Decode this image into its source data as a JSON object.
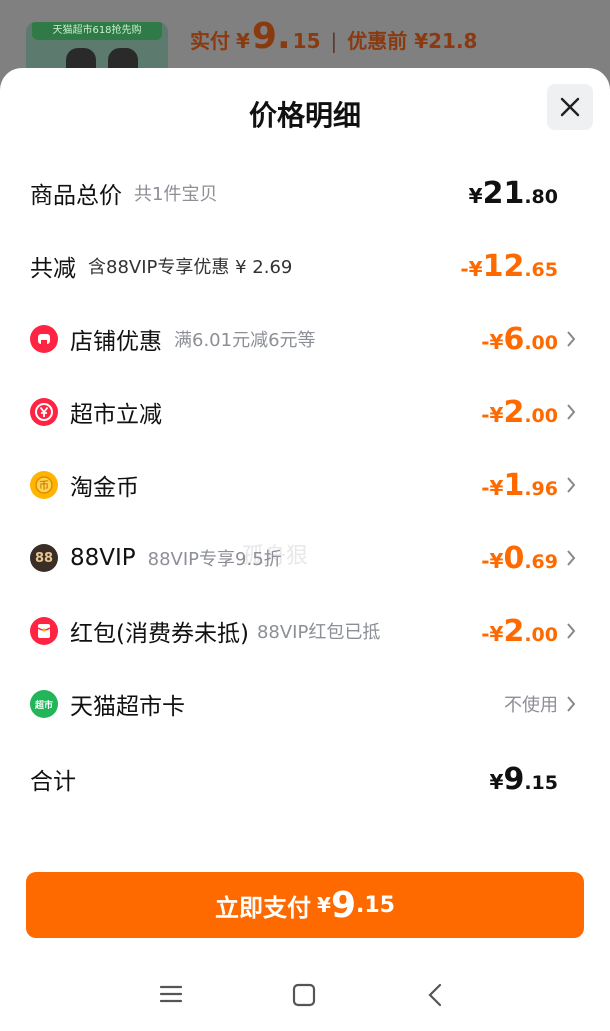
{
  "background": {
    "thumb_tag": "天猫超市618抢先购",
    "price_label": "实付",
    "price_currency": "¥",
    "price_int": "9.",
    "price_dec": "15",
    "price_before": "优惠前 ¥21.8"
  },
  "sheet": {
    "title": "价格明细",
    "rows": [
      {
        "label": "商品总价",
        "sub": "共1件宝贝",
        "currency": "¥",
        "int": "21",
        "dec": ".80"
      },
      {
        "label": "共减",
        "sub": "含88VIP专享优惠 ¥ 2.69",
        "currency": "-¥",
        "int": "12",
        "dec": ".65"
      },
      {
        "label": "店铺优惠",
        "sub": "满6.01元减6元等",
        "currency": "-¥",
        "int": "6",
        "dec": ".00"
      },
      {
        "label": "超市立减",
        "sub": "",
        "currency": "-¥",
        "int": "2",
        "dec": ".00"
      },
      {
        "label": "淘金币",
        "sub": "",
        "currency": "-¥",
        "int": "1",
        "dec": ".96"
      },
      {
        "label": "88VIP",
        "sub": "88VIP专享9.5折",
        "currency": "-¥",
        "int": "0",
        "dec": ".69"
      },
      {
        "label": "红包(消费券未抵)",
        "sub": "88VIP红包已抵",
        "currency": "-¥",
        "int": "2",
        "dec": ".00"
      },
      {
        "label": "天猫超市卡",
        "sub": "",
        "right_text": "不使用"
      },
      {
        "label": "合计",
        "sub": "",
        "currency": "¥",
        "int": "9",
        "dec": ".15"
      }
    ],
    "icons": {
      "shop": "店",
      "supermarket": "¥",
      "coin": "币",
      "vip": "88",
      "redpacket": "",
      "card": "超市"
    },
    "watermark": "孤舟狠",
    "pay_button": {
      "label": "立即支付",
      "currency": "¥",
      "int": "9",
      "dec": ".15"
    }
  },
  "colors": {
    "accent": "#ff6a00",
    "text": "#111111",
    "muted": "#8c8f96"
  }
}
